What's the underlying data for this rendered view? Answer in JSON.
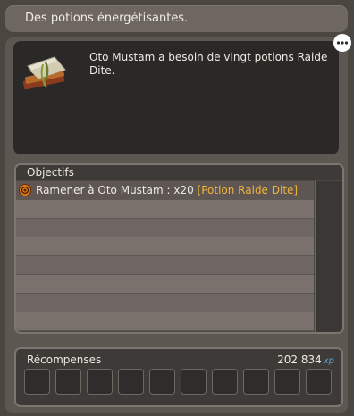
{
  "quest": {
    "title": "Des potions énergétisantes.",
    "description": "Oto Mustam a besoin de vingt potions Raide Dite."
  },
  "objectives": {
    "header": "Objectifs",
    "items": [
      {
        "text": "Ramener à Oto Mustam : x20",
        "item": "[Potion Raide Dite]",
        "icon": "orange-quest-icon"
      }
    ]
  },
  "rewards": {
    "label": "Récompenses",
    "xp_value": "202 834",
    "xp_unit": "xp",
    "slot_count": 10
  },
  "icons": {
    "quest_book": "book-scroll-icon",
    "chat": "speech-bubble-icon"
  },
  "colors": {
    "item_highlight": "#f2b33d",
    "xp_unit": "#5aa2d6"
  }
}
